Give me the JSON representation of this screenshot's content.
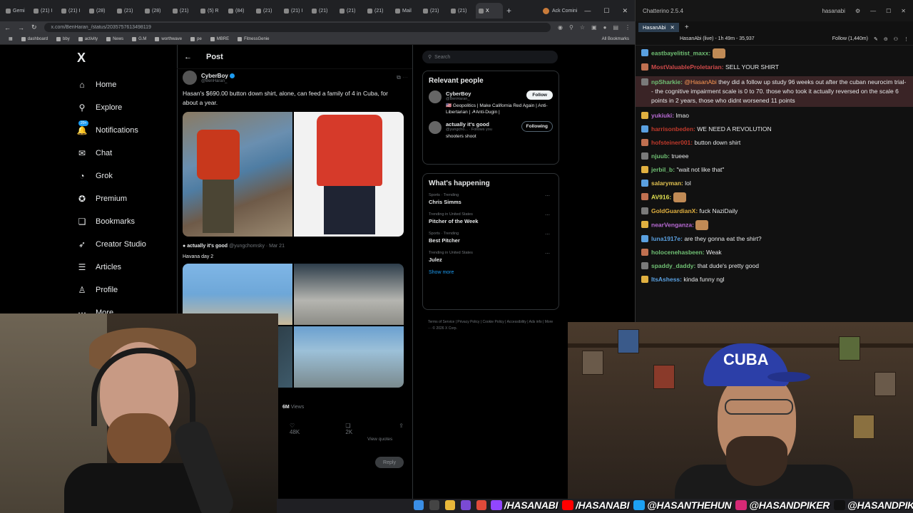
{
  "browser": {
    "tabs": [
      "Gemi",
      "(21) I",
      "(21) I",
      "(28)",
      "(21)",
      "(28)",
      "(21)",
      "(5) R",
      "(84)",
      "(21)",
      "(21) I",
      "(21)",
      "(21)",
      "(21)",
      "Mail",
      "(21)",
      "(21)",
      "X"
    ],
    "profile_label": "Ack Comini",
    "url": "x.com/BenHaran_/status/2035757613498119",
    "bookmarks": [
      "dashboard",
      "bby",
      "activity",
      "News",
      "G.M",
      "worthwave",
      "pe",
      "MBRE",
      "FitnessGenie"
    ],
    "all_bookmarks": "All Bookmarks"
  },
  "x": {
    "logo": "X",
    "nav": [
      {
        "label": "Home",
        "icon": "home-icon",
        "glyph": "⌂"
      },
      {
        "label": "Explore",
        "icon": "search-icon",
        "glyph": "⚲"
      },
      {
        "label": "Notifications",
        "icon": "bell-icon",
        "glyph": "🔔"
      },
      {
        "label": "Chat",
        "icon": "mail-icon",
        "glyph": "✉"
      },
      {
        "label": "Grok",
        "icon": "grok-icon",
        "glyph": "◔"
      },
      {
        "label": "Premium",
        "icon": "premium-icon",
        "glyph": "✪"
      },
      {
        "label": "Bookmarks",
        "icon": "bookmark-icon",
        "glyph": "❏"
      },
      {
        "label": "Creator Studio",
        "icon": "rocket-icon",
        "glyph": "➶"
      },
      {
        "label": "Articles",
        "icon": "articles-icon",
        "glyph": "☰"
      },
      {
        "label": "Profile",
        "icon": "profile-icon",
        "glyph": "♙"
      },
      {
        "label": "More",
        "icon": "more-icon",
        "glyph": "⋯"
      }
    ],
    "notif_badge": "20+",
    "header_title": "Post",
    "post": {
      "name": "CyberBoy",
      "handle": "@BenHaran_",
      "text": "Hasan's $690.00 button down shirt, alone, can feed a family of 4 in Cuba, for about a year.",
      "quote_name": "actually it's good",
      "quote_meta": "@yungchomsky · Mar 21",
      "quote_text": "Havana day 2",
      "views_value": "6M",
      "views_label": "Views",
      "likes": "48K",
      "bookmarks": "2K",
      "view_quotes": "View quotes",
      "reply_button": "Reply"
    },
    "search_placeholder": "Search",
    "relevant": {
      "title": "Relevant people",
      "people": [
        {
          "name": "CyberBoy",
          "handle": "@BenHaran_",
          "bio": "🇺🇸 Geopolitics | Make California Red Again | Anti-Libertarian | ☭Anti-Dugin |",
          "button": "Follow"
        },
        {
          "name": "actually it's good",
          "handle": "@yungcho... · Follows you",
          "bio": "shooters shoot",
          "button": "Following"
        }
      ]
    },
    "happening": {
      "title": "What's happening",
      "trends": [
        {
          "context": "Sports · Trending",
          "title": "Chris Simms"
        },
        {
          "context": "Trending in United States",
          "title": "Pitcher of the Week"
        },
        {
          "context": "Sports · Trending",
          "title": "Best Pitcher"
        },
        {
          "context": "Trending in United States",
          "title": "Julez"
        }
      ],
      "show_more": "Show more"
    },
    "footer": "Terms of Service | Privacy Policy | Cookie Policy | Accessibility | Ads info | More ··· © 2026 X Corp."
  },
  "chat": {
    "app_title": "Chatterino 2.5.4",
    "user": "hasanabi",
    "tab": "HasanAbi",
    "channel_status": "HasanAbi (live) - 1h 49m - 35,937",
    "follow_label": "Follow (1,440m)",
    "messages": [
      {
        "user": "eastbayelitist_maxx:",
        "color": "#6fbf73",
        "text": ""
      },
      {
        "user": "MostValuableProletarian:",
        "color": "#d04a4a",
        "text": "SELL YOUR SHIRT"
      },
      {
        "user": "npSharkie:",
        "color": "#6fbf73",
        "mention": "@HasanAbi",
        "text": "they did a follow up study 96 weeks out after the cuban neurocim trial-- the cognitive impairment scale is 0 to 70. those who took it actually reversed on the scale 6 points in 2 years, those who didnt worsened 11 points"
      },
      {
        "user": "yukiuki:",
        "color": "#b86ad4",
        "text": "lmao"
      },
      {
        "user": "harrisonbeden:",
        "color": "#c0392b",
        "text": "WE NEED A REVOLUTION"
      },
      {
        "user": "hofsteiner001:",
        "color": "#c0392b",
        "text": "button down shirt"
      },
      {
        "user": "njuub:",
        "color": "#6fbf73",
        "text": "trueee"
      },
      {
        "user": "jerbil_b:",
        "color": "#6fbf73",
        "text": "\"wait not like that\""
      },
      {
        "user": "salaryman:",
        "color": "#e0c050",
        "text": "lol"
      },
      {
        "user": "AV916:",
        "color": "#e0e050",
        "text": ""
      },
      {
        "user": "GoldGuardianX:",
        "color": "#e0b040",
        "text": "fuck NaziDaily"
      },
      {
        "user": "nearVenganza:",
        "color": "#b86ad4",
        "text": ""
      },
      {
        "user": "luna1917e:",
        "color": "#5aa0e0",
        "text": "are they gonna eat the shirt?"
      },
      {
        "user": "holocenehasbeen:",
        "color": "#6fbf73",
        "text": "Weak"
      },
      {
        "user": "spaddy_daddy:",
        "color": "#6fbf73",
        "text": "that dude's pretty good"
      },
      {
        "user": "ItsAshess:",
        "color": "#5aa0e0",
        "text": "kinda funny ngl"
      }
    ]
  },
  "cam_right": {
    "cap_text": "CUBA"
  },
  "socials": [
    {
      "icon": "twitch-icon",
      "color": "#9146ff",
      "label": "/HASANABI"
    },
    {
      "icon": "youtube-icon",
      "color": "#ff0000",
      "label": "/HASANABI"
    },
    {
      "icon": "twitter-icon",
      "color": "#1da1f2",
      "label": "@HASANTHEHUN"
    },
    {
      "icon": "instagram-icon",
      "color": "#d62976",
      "label": "@HASANDPIKER"
    },
    {
      "icon": "tiktok-icon",
      "color": "#111111",
      "label": "@HASANDPIKER"
    }
  ]
}
